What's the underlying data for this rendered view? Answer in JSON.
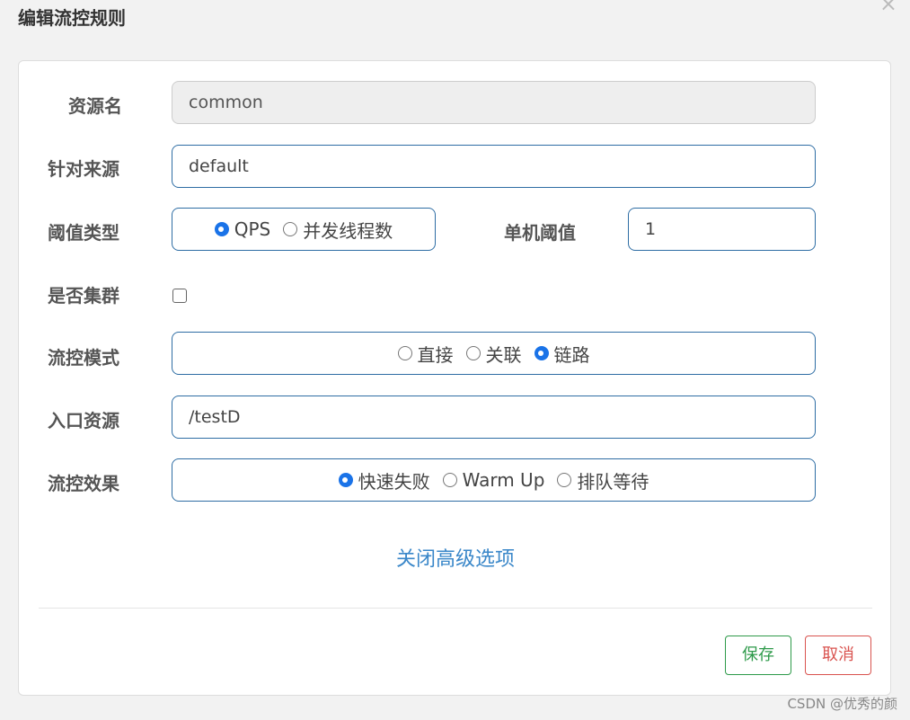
{
  "dialog": {
    "title": "编辑流控规则",
    "close_symbol": "×"
  },
  "form": {
    "resource_name": {
      "label": "资源名",
      "value": "common"
    },
    "limit_app": {
      "label": "针对来源",
      "value": "default"
    },
    "grade": {
      "label": "阈值类型",
      "options": [
        "QPS",
        "并发线程数"
      ],
      "selected": "QPS"
    },
    "threshold": {
      "label": "单机阈值",
      "value": "1"
    },
    "cluster": {
      "label": "是否集群",
      "checked": false
    },
    "strategy": {
      "label": "流控模式",
      "options": [
        "直接",
        "关联",
        "链路"
      ],
      "selected": "链路"
    },
    "ref_resource": {
      "label": "入口资源",
      "value": "/testD"
    },
    "control_behavior": {
      "label": "流控效果",
      "options": [
        "快速失败",
        "Warm Up",
        "排队等待"
      ],
      "selected": "快速失败"
    },
    "toggle_advanced": "关闭高级选项"
  },
  "footer": {
    "save_label": "保存",
    "cancel_label": "取消"
  },
  "watermark": "CSDN @优秀的颜",
  "colors": {
    "accent_blue": "#1a73e8",
    "border_blue": "#2e6da4",
    "link_blue": "#3a87c9",
    "save_green": "#2e9a4a",
    "cancel_red": "#d9534f"
  }
}
